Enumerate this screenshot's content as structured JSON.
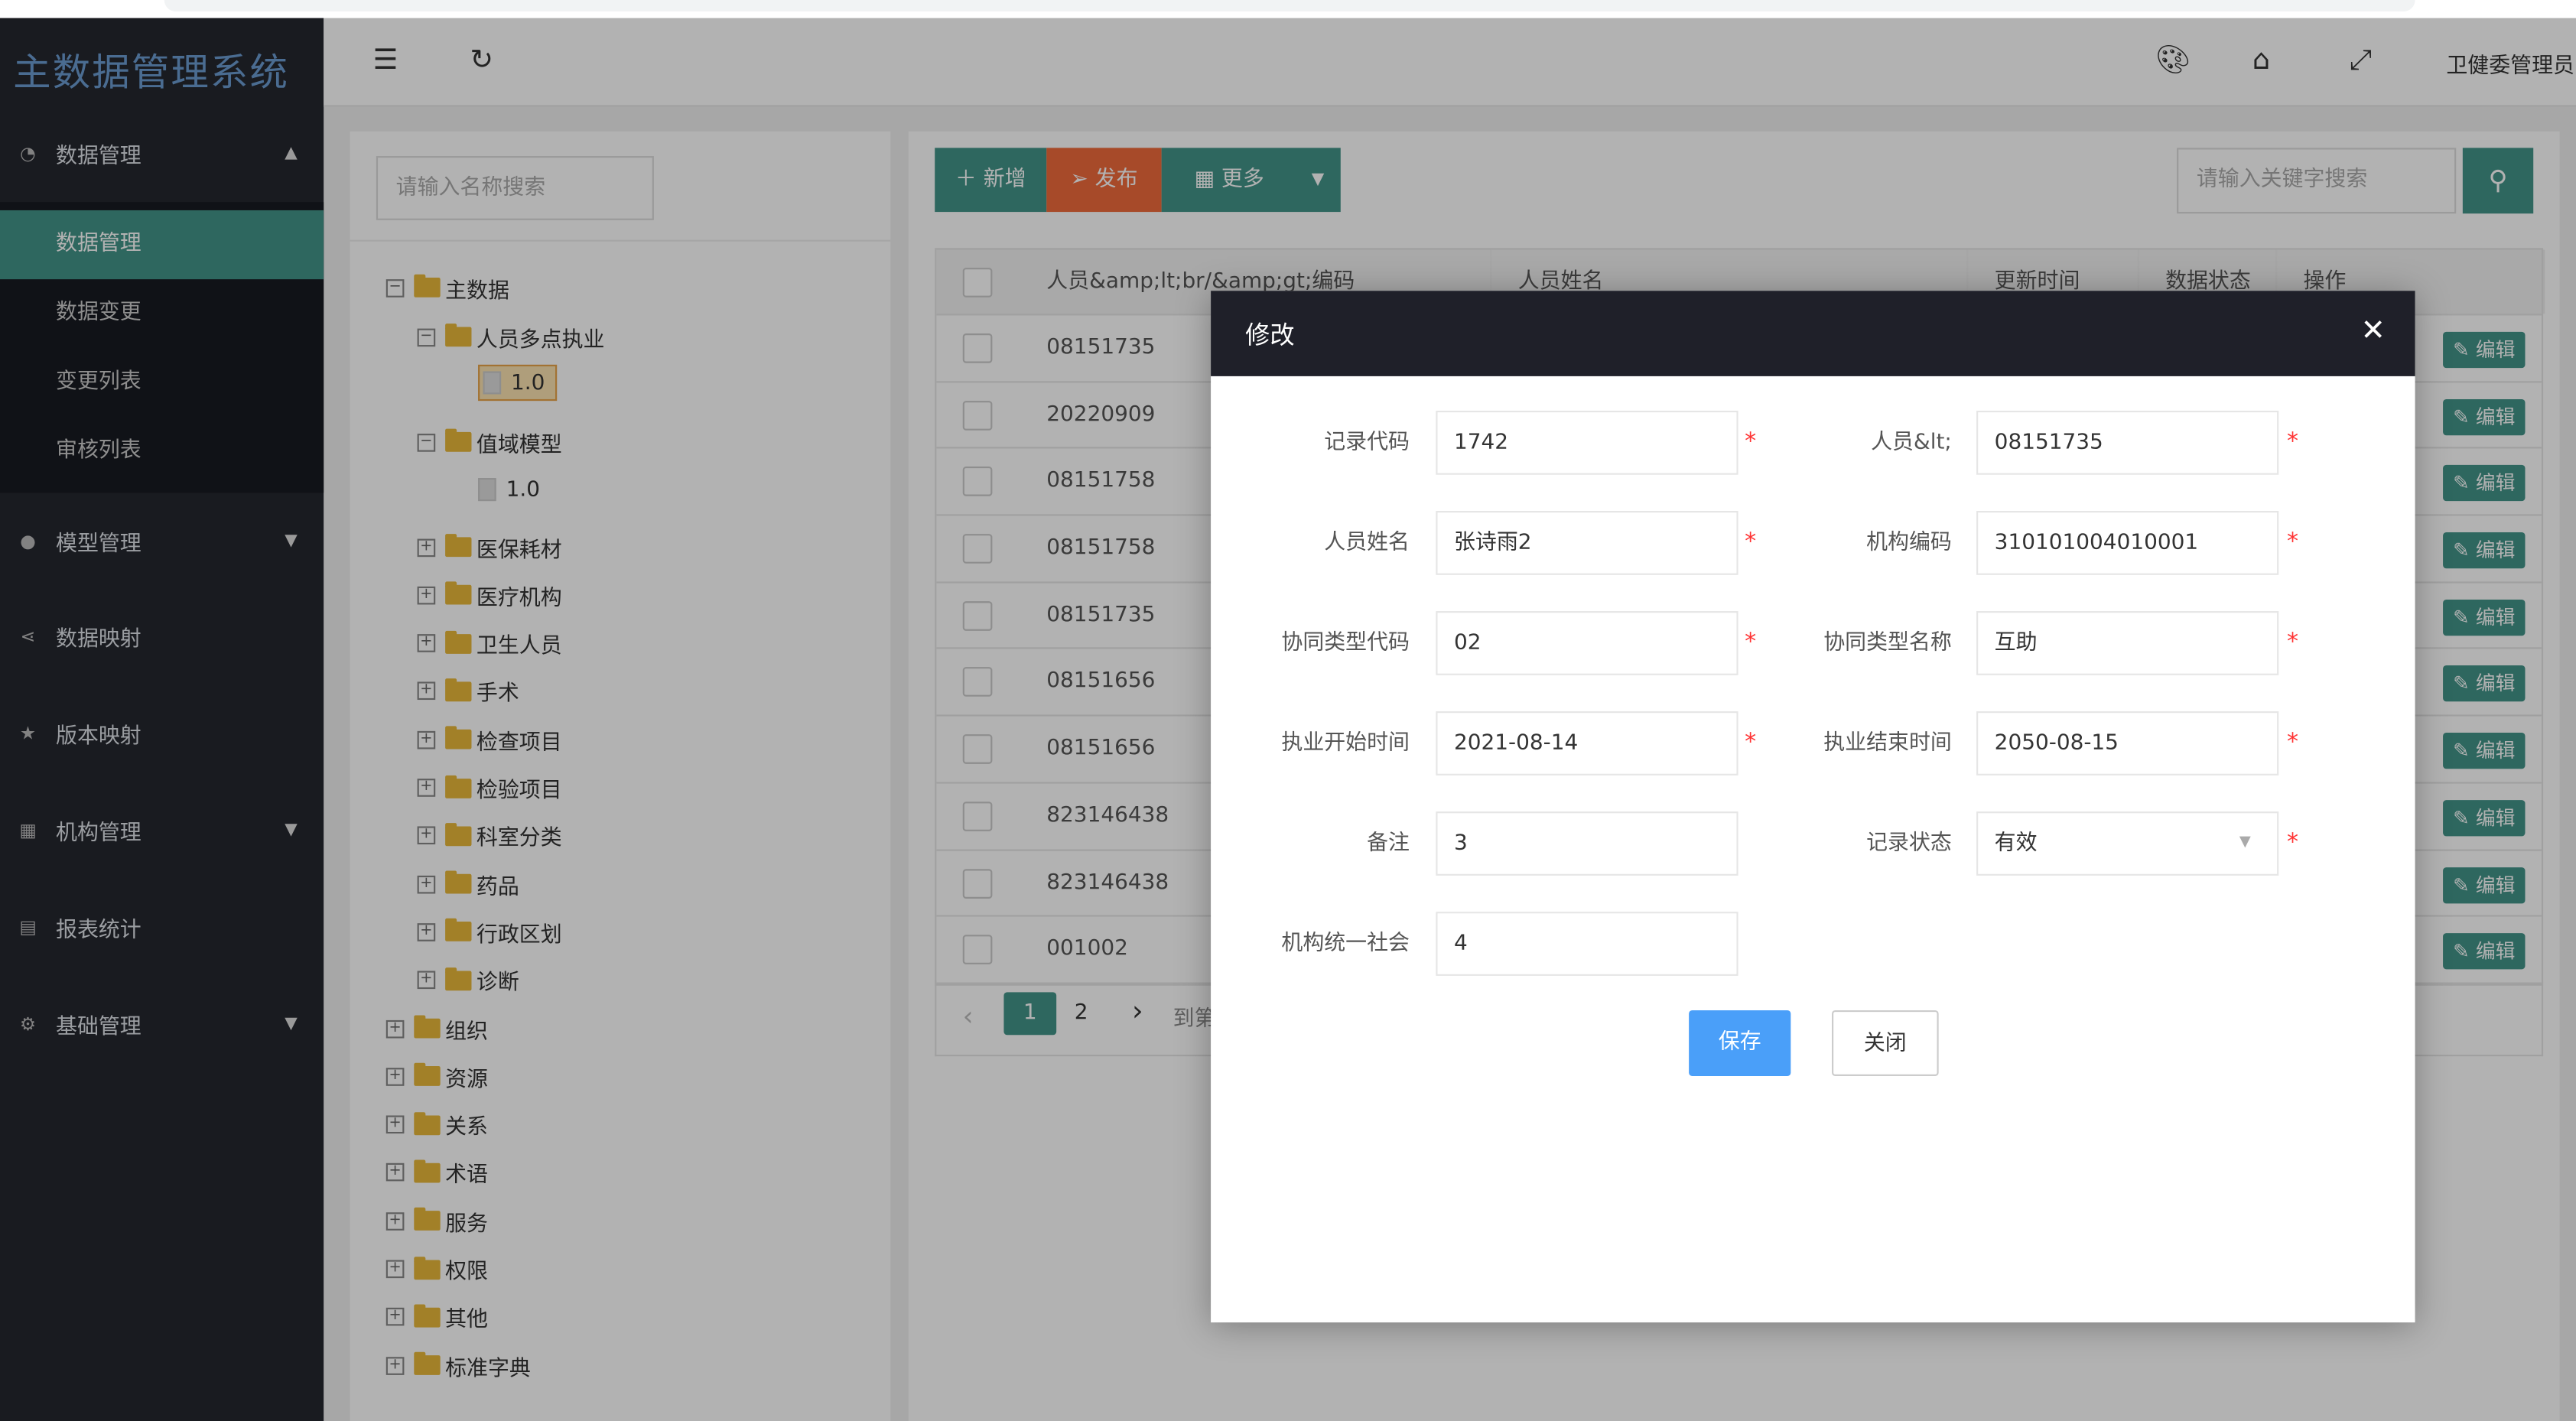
{
  "app": {
    "title": "主数据管理系统",
    "user": "卫健委管理员"
  },
  "colors": {
    "accent": "#429488",
    "publish": "#f06a3c",
    "primary": "#4a9ff9",
    "sidebar": "#25272f"
  },
  "sidebar": {
    "groups": [
      {
        "label": "数据管理",
        "icon": "dashboard-icon",
        "expanded": true,
        "subitems": [
          {
            "label": "数据管理",
            "active": true
          },
          {
            "label": "数据变更"
          },
          {
            "label": "变更列表"
          },
          {
            "label": "审核列表"
          }
        ]
      },
      {
        "label": "模型管理",
        "icon": "circle-icon",
        "expanded": false
      },
      {
        "label": "数据映射",
        "icon": "share-icon"
      },
      {
        "label": "版本映射",
        "icon": "star-icon"
      },
      {
        "label": "机构管理",
        "icon": "apps-icon",
        "expanded": false
      },
      {
        "label": "报表统计",
        "icon": "table-icon"
      },
      {
        "label": "基础管理",
        "icon": "gear-icon",
        "expanded": false
      }
    ]
  },
  "header": {
    "icons": [
      "menu-fold-icon",
      "refresh-icon",
      "palette-icon",
      "tag-icon",
      "fullscreen-icon"
    ]
  },
  "tree": {
    "search_placeholder": "请输入名称搜索",
    "nodes": [
      {
        "label": "主数据",
        "level": 0,
        "type": "folder",
        "expanded": true
      },
      {
        "label": "人员多点执业",
        "level": 1,
        "type": "folder",
        "expanded": true
      },
      {
        "label": "1.0",
        "level": 2,
        "type": "doc",
        "selected": true
      },
      {
        "label": "值域模型",
        "level": 1,
        "type": "folder",
        "expanded": true
      },
      {
        "label": "1.0",
        "level": 2,
        "type": "doc"
      },
      {
        "label": "医保耗材",
        "level": 1,
        "type": "folder"
      },
      {
        "label": "医疗机构",
        "level": 1,
        "type": "folder"
      },
      {
        "label": "卫生人员",
        "level": 1,
        "type": "folder"
      },
      {
        "label": "手术",
        "level": 1,
        "type": "folder"
      },
      {
        "label": "检查项目",
        "level": 1,
        "type": "folder"
      },
      {
        "label": "检验项目",
        "level": 1,
        "type": "folder"
      },
      {
        "label": "科室分类",
        "level": 1,
        "type": "folder"
      },
      {
        "label": "药品",
        "level": 1,
        "type": "folder"
      },
      {
        "label": "行政区划",
        "level": 1,
        "type": "folder"
      },
      {
        "label": "诊断",
        "level": 1,
        "type": "folder"
      },
      {
        "label": "组织",
        "level": 0,
        "type": "folder"
      },
      {
        "label": "资源",
        "level": 0,
        "type": "folder"
      },
      {
        "label": "关系",
        "level": 0,
        "type": "folder"
      },
      {
        "label": "术语",
        "level": 0,
        "type": "folder"
      },
      {
        "label": "服务",
        "level": 0,
        "type": "folder"
      },
      {
        "label": "权限",
        "level": 0,
        "type": "folder"
      },
      {
        "label": "其他",
        "level": 0,
        "type": "folder"
      },
      {
        "label": "标准字典",
        "level": 0,
        "type": "folder"
      }
    ]
  },
  "toolbar": {
    "add": "新增",
    "publish": "发布",
    "more": "更多",
    "search_placeholder": "请输入关键字搜索"
  },
  "table": {
    "columns": [
      "人员&amp;lt;br/&amp;gt;编码",
      "人员姓名",
      "更新时间",
      "数据状态",
      "操作"
    ],
    "edit_label": "编辑",
    "rows": [
      "08151735",
      "20220909",
      "08151758",
      "08151758",
      "08151735",
      "08151656",
      "08151656",
      "823146438",
      "823146438",
      "001002"
    ]
  },
  "pagination": {
    "pages": [
      "1",
      "2"
    ],
    "current": "1",
    "goto": "到第"
  },
  "modal": {
    "title": "修改",
    "fields": [
      {
        "label": "记录代码",
        "value": "1742",
        "required": true
      },
      {
        "label": "人员&lt;",
        "value": "08151735",
        "required": true
      },
      {
        "label": "人员姓名",
        "value": "张诗雨2",
        "required": true
      },
      {
        "label": "机构编码",
        "value": "310101004010001",
        "required": true
      },
      {
        "label": "协同类型代码",
        "value": "02",
        "required": true
      },
      {
        "label": "协同类型名称",
        "value": "互助",
        "required": true
      },
      {
        "label": "执业开始时间",
        "value": "2021-08-14",
        "required": true
      },
      {
        "label": "执业结束时间",
        "value": "2050-08-15",
        "required": true
      },
      {
        "label": "备注",
        "value": "3",
        "required": false
      },
      {
        "label": "记录状态",
        "value": "有效",
        "required": true,
        "select": true
      },
      {
        "label": "机构统一社会",
        "value": "4",
        "required": false
      }
    ],
    "save": "保存",
    "close": "关闭"
  }
}
